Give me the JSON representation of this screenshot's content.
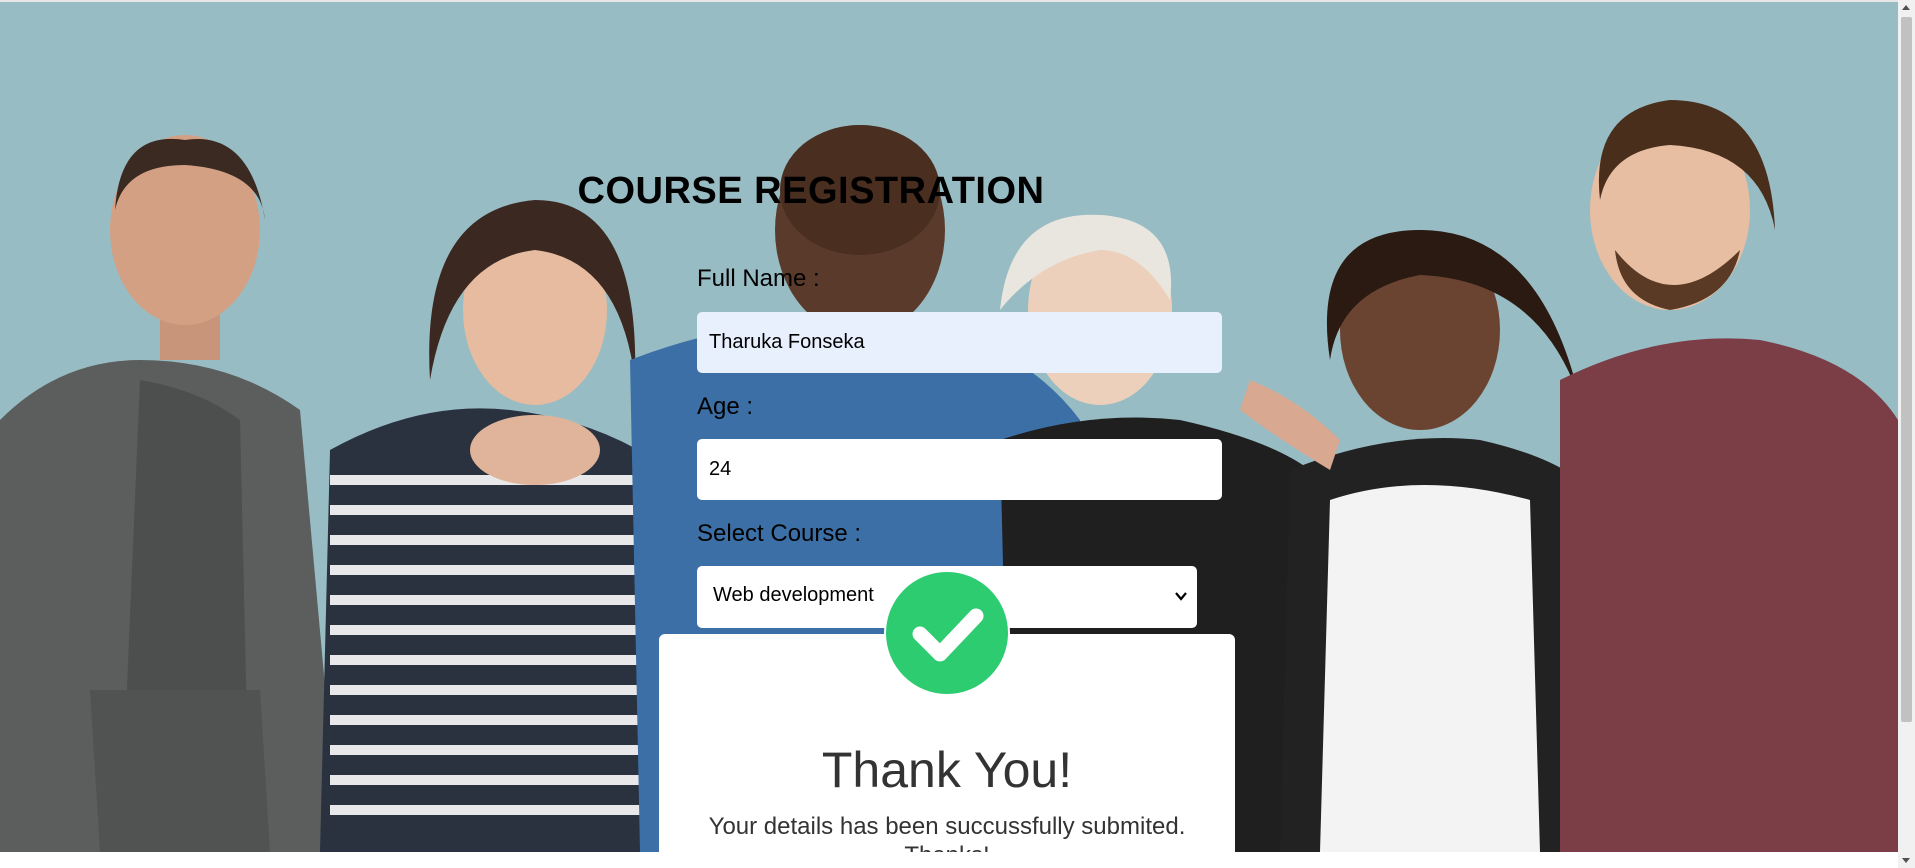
{
  "form": {
    "title": "COURSE REGISTRATION",
    "full_name_label": "Full Name :",
    "full_name_value": "Tharuka Fonseka",
    "age_label": "Age :",
    "age_value": "24",
    "course_label": "Select Course :",
    "course_selected": "Web development"
  },
  "popup": {
    "title": "Thank You!",
    "message": "Your details has been succussfully submited. Thanks!",
    "icon": "check-icon"
  },
  "colors": {
    "background": "#98bcc4",
    "success": "#2ecc71",
    "autofill": "#e8f0fe"
  }
}
